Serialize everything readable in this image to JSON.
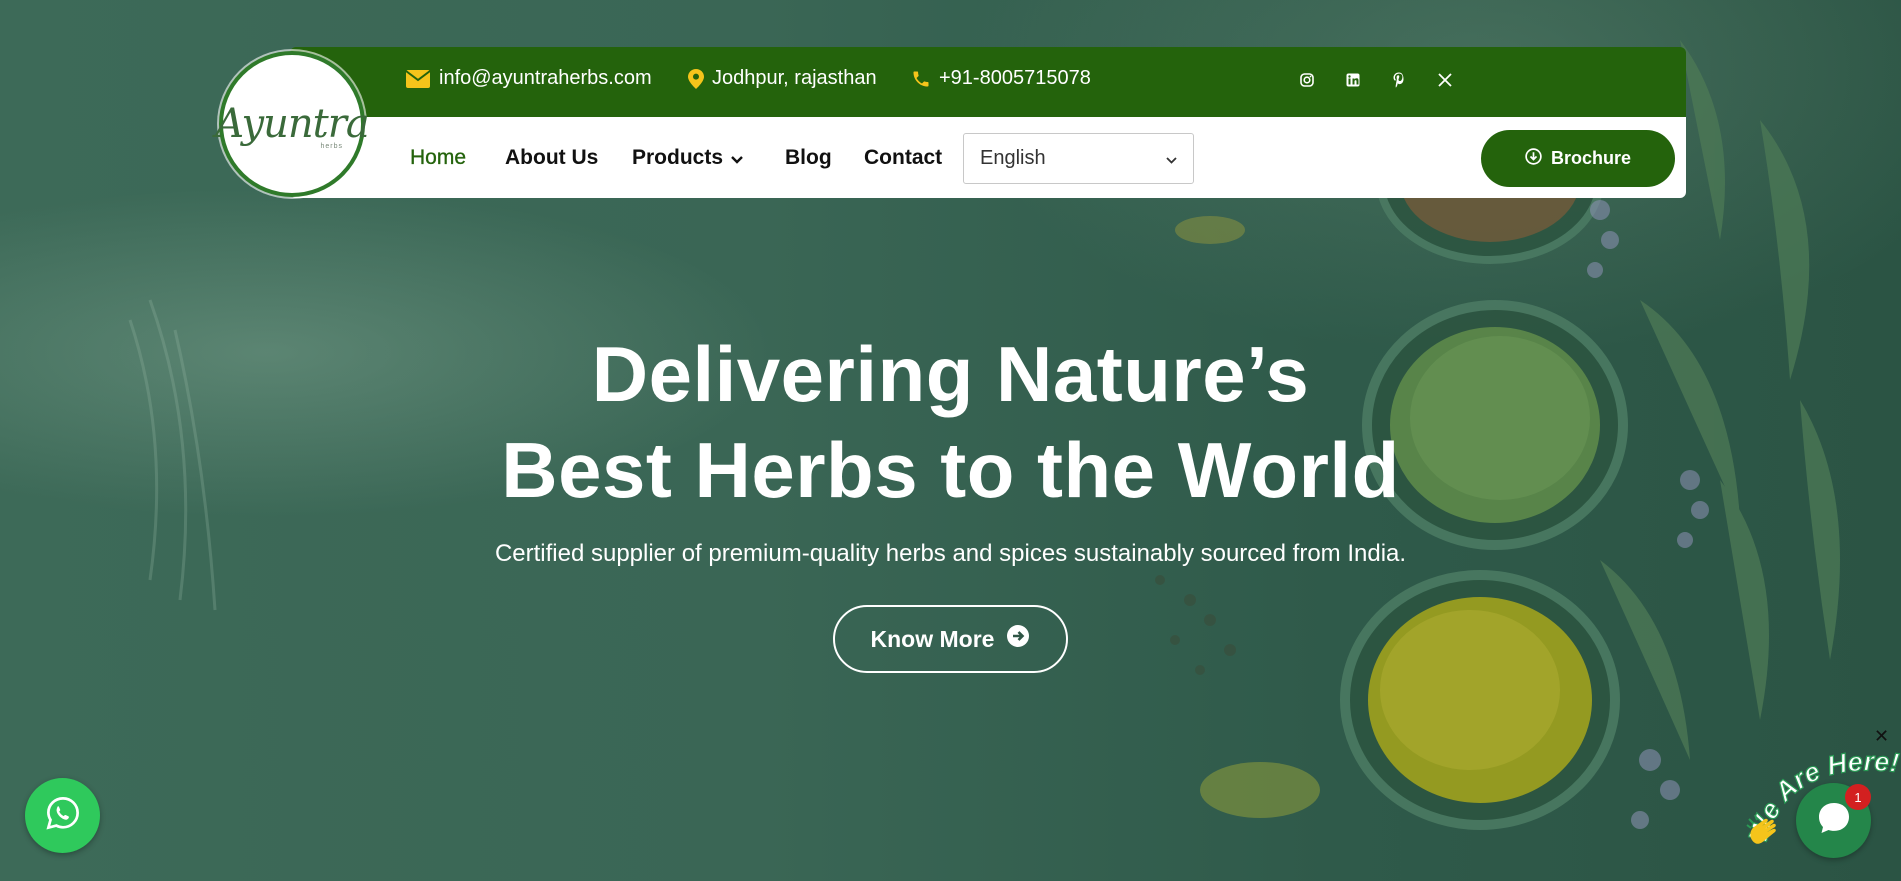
{
  "header": {
    "logo_text": "Ayuntra",
    "logo_sub": "herbs",
    "email": "info@ayuntraherbs.com",
    "location": "Jodhpur, rajasthan",
    "phone": "+91-8005715078",
    "social": [
      "instagram-icon",
      "linkedin-icon",
      "pinterest-icon",
      "x-icon"
    ]
  },
  "nav": {
    "items": [
      {
        "label": "Home",
        "active": true
      },
      {
        "label": "About Us"
      },
      {
        "label": "Products",
        "has_dropdown": true
      },
      {
        "label": "Blog"
      },
      {
        "label": "Contact"
      }
    ],
    "language": "English",
    "brochure_label": "Brochure"
  },
  "hero": {
    "title_line1": "Delivering Nature’s",
    "title_line2": "Best Herbs to the World",
    "subtitle": "Certified supplier of premium-quality herbs and spices sustainably sourced from India.",
    "cta_label": "Know More"
  },
  "widgets": {
    "chat_badge": "1",
    "chat_tagline": "We Are Here!",
    "close_glyph": "✕"
  },
  "colors": {
    "brand_green": "#24630c",
    "accent_yellow": "#f5c41b",
    "whatsapp_green": "#2fc95c"
  }
}
